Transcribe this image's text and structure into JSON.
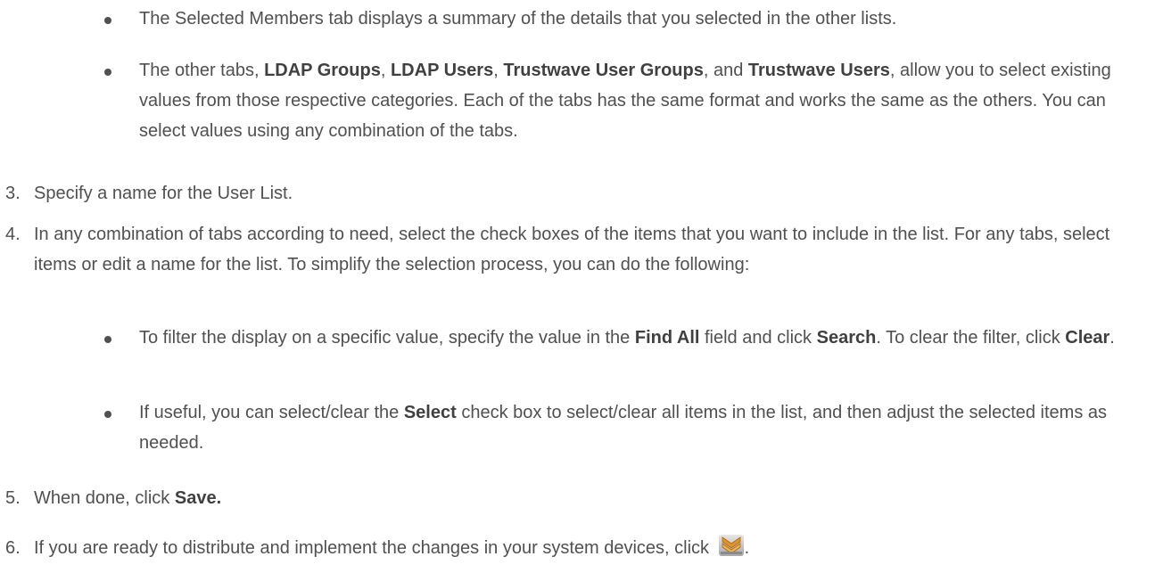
{
  "bullets_top": [
    {
      "text": "The Selected Members tab displays a summary of the details that you selected in the other lists."
    },
    {
      "parts": [
        "The other tabs, ",
        "LDAP Groups",
        ", ",
        "LDAP Users",
        ", ",
        "Trustwave User Groups",
        ", and ",
        "Trustwave Users",
        ", allow you to select existing values from those respective categories. Each of the tabs has the same format and works the same as the others. You can select values using any combination of the tabs."
      ]
    }
  ],
  "steps": [
    {
      "num": "3.",
      "text": "Specify a name for the User List."
    },
    {
      "num": "4.",
      "text": "In any combination of tabs according to need, select the check boxes of the items that you want to include in the list. For any tabs, select items or edit a name for the list. To simplify the selection process, you can do the following:"
    },
    {
      "num": "5.",
      "prefix": "When done, click ",
      "bold": "Save."
    },
    {
      "num": "6.",
      "text": "If you are ready to distribute and implement the changes in your system devices, click ",
      "suffix": ".",
      "icon": "distribute-changes-icon"
    }
  ],
  "bullets_step4": [
    {
      "parts": [
        "To filter the display on a specific value, specify the value in the ",
        "Find All",
        " field and click ",
        "Search",
        ". To clear the filter, click ",
        "Clear",
        "."
      ]
    },
    {
      "parts": [
        "If useful, you can select/clear the ",
        "Select",
        " check box to select/clear all items in the list, and then adjust the selected items as needed."
      ]
    }
  ],
  "colors": {
    "text": "#505050",
    "icon_chevron": "#d98a1c",
    "icon_bg": "#c8c8c8"
  }
}
